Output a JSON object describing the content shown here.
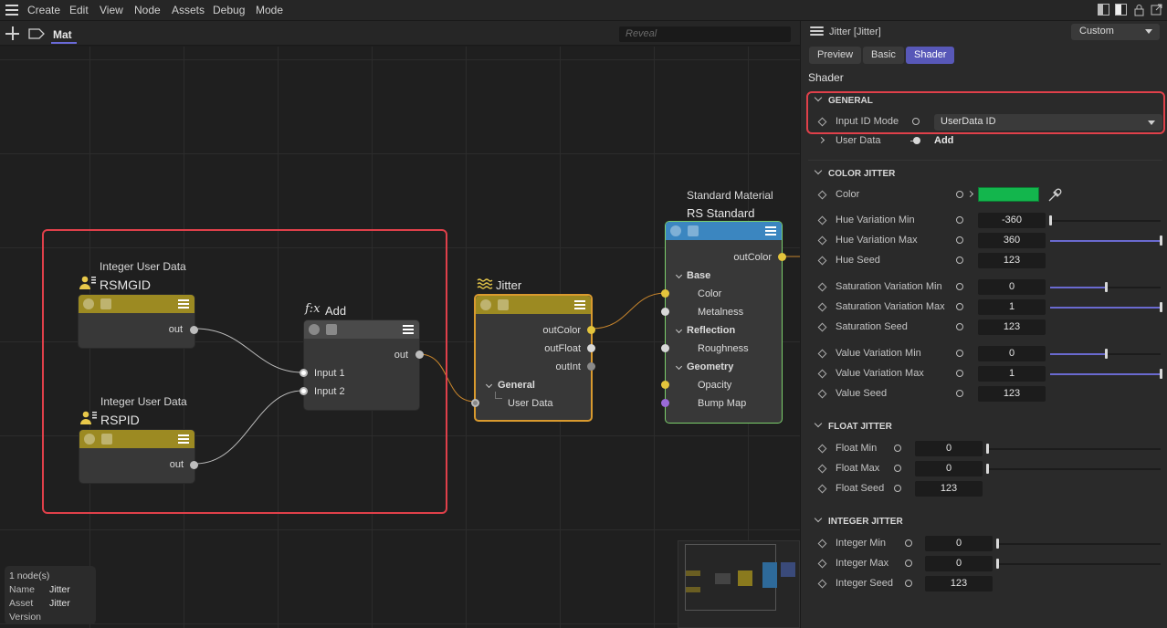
{
  "menu": {
    "items": [
      "Create",
      "Edit",
      "View",
      "Node",
      "Assets",
      "Debug",
      "Mode"
    ]
  },
  "toolbar": {
    "tab_label": "Mat",
    "search_placeholder": "Reveal"
  },
  "nodes": {
    "rsmgid": {
      "header": "Integer User Data",
      "title": "RSMGID",
      "out": "out",
      "color": "#9c8a22"
    },
    "rspid": {
      "header": "Integer User Data",
      "title": "RSPID",
      "out": "out",
      "color": "#9c8a22"
    },
    "add": {
      "fx": "f:x",
      "title": "Add",
      "out": "out",
      "input1": "Input 1",
      "input2": "Input 2",
      "color": "#4a4a4a"
    },
    "jitter": {
      "title": "Jitter",
      "outColor": "outColor",
      "outFloat": "outFloat",
      "outInt": "outInt",
      "group": "General",
      "userdata": "User Data",
      "color": "#9c8a22",
      "border": "#d99a2e"
    },
    "material": {
      "header": "Standard Material",
      "title": "RS Standard",
      "outColor": "outColor",
      "base": "Base",
      "color_port": "Color",
      "metalness": "Metalness",
      "reflection": "Reflection",
      "roughness": "Roughness",
      "geometry": "Geometry",
      "opacity": "Opacity",
      "bumpmap": "Bump Map",
      "color": "#3b86c0",
      "border": "#7ccf6c"
    }
  },
  "info": {
    "count": "1 node(s)",
    "name_key": "Name",
    "name_val": "Jitter",
    "asset_key": "Asset",
    "asset_val": "Jitter",
    "version_key": "Version"
  },
  "panel": {
    "title": "Jitter [Jitter]",
    "preset": "Custom",
    "tabs": [
      "Preview",
      "Basic",
      "Shader"
    ],
    "active_tab": "Shader",
    "heading": "Shader",
    "general": {
      "label": "GENERAL",
      "input_id_mode_label": "Input ID Mode",
      "input_id_mode_value": "UserData ID",
      "user_data_label": "User Data",
      "user_data_value": "Add"
    },
    "color_jitter": {
      "label": "COLOR JITTER",
      "color_label": "Color",
      "color_value": "#13b64d",
      "rows": [
        {
          "label": "Hue Variation Min",
          "value": "-360",
          "fraction": 0.0
        },
        {
          "label": "Hue Variation Max",
          "value": "360",
          "fraction": 1.0
        },
        {
          "label": "Hue Seed",
          "value": "123"
        },
        {
          "label": "Saturation Variation Min",
          "value": "0",
          "fraction": 0.5
        },
        {
          "label": "Saturation Variation Max",
          "value": "1",
          "fraction": 1.0
        },
        {
          "label": "Saturation Seed",
          "value": "123"
        },
        {
          "label": "Value Variation Min",
          "value": "0",
          "fraction": 0.5
        },
        {
          "label": "Value Variation Max",
          "value": "1",
          "fraction": 1.0
        },
        {
          "label": "Value Seed",
          "value": "123"
        }
      ]
    },
    "float_jitter": {
      "label": "FLOAT JITTER",
      "rows": [
        {
          "label": "Float Min",
          "value": "0",
          "fraction": 0.0
        },
        {
          "label": "Float Max",
          "value": "0",
          "fraction": 0.0
        },
        {
          "label": "Float Seed",
          "value": "123"
        }
      ]
    },
    "integer_jitter": {
      "label": "INTEGER JITTER",
      "rows": [
        {
          "label": "Integer Min",
          "value": "0",
          "fraction": 0.0
        },
        {
          "label": "Integer Max",
          "value": "0",
          "fraction": 0.0
        },
        {
          "label": "Integer Seed",
          "value": "123"
        }
      ]
    }
  }
}
